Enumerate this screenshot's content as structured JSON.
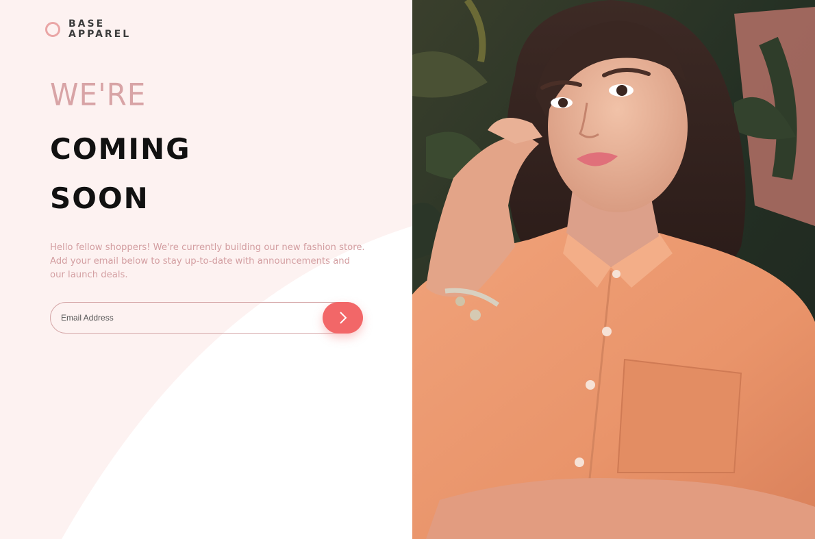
{
  "brand": {
    "line1": "BASE",
    "line2": "APPAREL"
  },
  "hero": {
    "light": "WE'RE",
    "line2": "COMING",
    "line3": "SOON"
  },
  "intro": "Hello fellow shoppers! We're currently building our new fashion store. Add your email below to stay up-to-date with announcements and our launch deals.",
  "form": {
    "email_placeholder": "Email Address",
    "email_value": ""
  },
  "icons": {
    "submit": "chevron-right-icon",
    "logo": "ring-logo-icon"
  },
  "colors": {
    "accent": "#f26768",
    "muted_pink": "#d39ea1",
    "background": "#fdf2f1"
  }
}
